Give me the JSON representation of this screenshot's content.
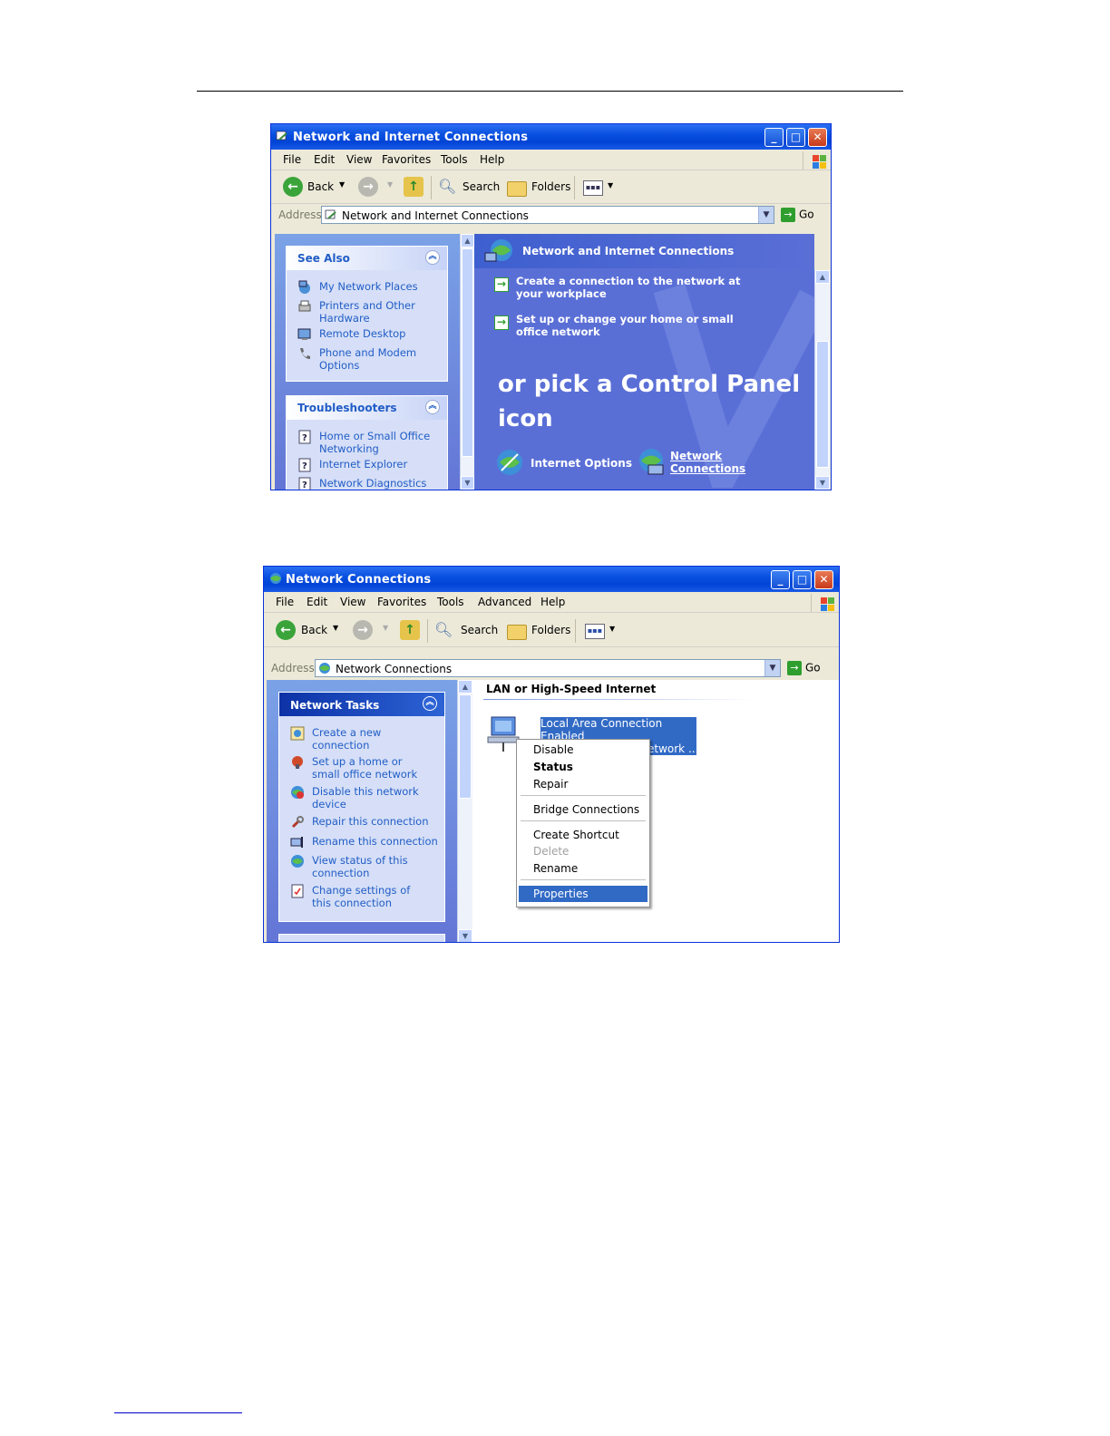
{
  "window1": {
    "title": "Network and Internet Connections",
    "menu": [
      "File",
      "Edit",
      "View",
      "Favorites",
      "Tools",
      "Help"
    ],
    "toolbar": {
      "back": "Back",
      "search": "Search",
      "folders": "Folders"
    },
    "address": {
      "label": "Address",
      "value": "Network and Internet Connections",
      "go": "Go"
    },
    "see_also": {
      "title": "See Also",
      "items": [
        "My Network Places",
        "Printers and Other Hardware",
        "Remote Desktop",
        "Phone and Modem Options"
      ]
    },
    "troubleshooters": {
      "title": "Troubleshooters",
      "items": [
        "Home or Small Office Networking",
        "Internet Explorer",
        "Network Diagnostics"
      ]
    },
    "main": {
      "header": "Network and Internet Connections",
      "tasks": [
        "Create a connection to the network at your workplace",
        "Set up or change your home or small office network"
      ],
      "pick_text": "or pick a Control Panel icon",
      "icons": [
        "Internet Options",
        "Network Connections"
      ]
    }
  },
  "window2": {
    "title": "Network Connections",
    "menu": [
      "File",
      "Edit",
      "View",
      "Favorites",
      "Tools",
      "Advanced",
      "Help"
    ],
    "toolbar": {
      "back": "Back",
      "search": "Search",
      "folders": "Folders"
    },
    "address": {
      "label": "Address",
      "value": "Network Connections",
      "go": "Go"
    },
    "network_tasks": {
      "title": "Network Tasks",
      "items": [
        "Create a new connection",
        "Set up a home or small office network",
        "Disable this network device",
        "Repair this connection",
        "Rename this connection",
        "View status of this connection",
        "Change settings of this connection"
      ]
    },
    "group_header": "LAN or High-Speed Internet",
    "connection": {
      "name": "Local Area Connection",
      "status": "Enabled",
      "device_partial": "etwork ..."
    },
    "context_menu": {
      "items": [
        "Disable",
        "Status",
        "Repair",
        "Bridge Connections",
        "Create Shortcut",
        "Delete",
        "Rename",
        "Properties"
      ],
      "highlighted": "Properties",
      "disabled": "Delete",
      "bold": "Status"
    }
  },
  "colors": {
    "title_blue": "#0a50e0",
    "task_pane": "#6375d6",
    "selection": "#316ac5"
  }
}
